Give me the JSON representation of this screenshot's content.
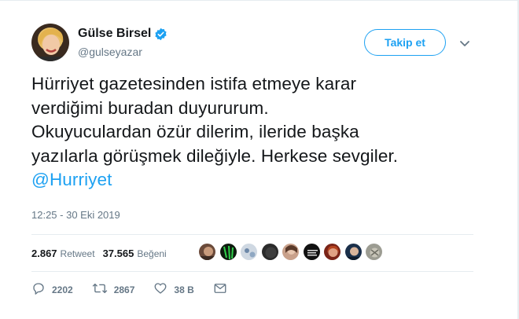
{
  "tweet": {
    "author_name": "Gülse Birsel",
    "handle": "@gulseyazar",
    "follow_label": "Takip et",
    "text_lines": [
      "Hürriyet gazetesinden istifa etmeye karar",
      "verdiğimi buradan duyururum.",
      "Okuyuculardan özür dilerim, ileride başka",
      "yazılarla görüşmek dileğiyle. Herkese sevgiler."
    ],
    "mention": "@Hurriyet",
    "timestamp": "12:25 - 30 Eki 2019"
  },
  "stats": {
    "retweet_count": "2.867",
    "retweet_label": "Retweet",
    "like_count": "37.565",
    "like_label": "Beğeni"
  },
  "actions": {
    "reply_count": "2202",
    "retweet_count": "2867",
    "like_count": "38 B"
  },
  "colors": {
    "accent": "#1da1f2",
    "muted": "#657786",
    "text": "#14171a"
  }
}
